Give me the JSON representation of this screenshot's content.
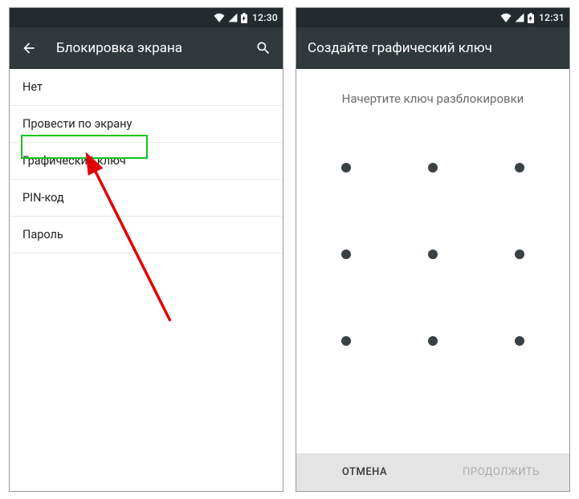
{
  "left": {
    "status": {
      "time": "12:30"
    },
    "appbar": {
      "title": "Блокировка экрана"
    },
    "options": [
      {
        "label": "Нет"
      },
      {
        "label": "Провести по экрану"
      },
      {
        "label": "Графический ключ",
        "highlighted": true
      },
      {
        "label": "PIN-код"
      },
      {
        "label": "Пароль"
      }
    ]
  },
  "right": {
    "status": {
      "time": "12:31"
    },
    "appbar": {
      "title": "Создайте графический ключ"
    },
    "instruction": "Начертите ключ разблокировки",
    "buttons": {
      "cancel": "ОТМЕНА",
      "continue": "ПРОДОЛЖИТЬ"
    }
  }
}
